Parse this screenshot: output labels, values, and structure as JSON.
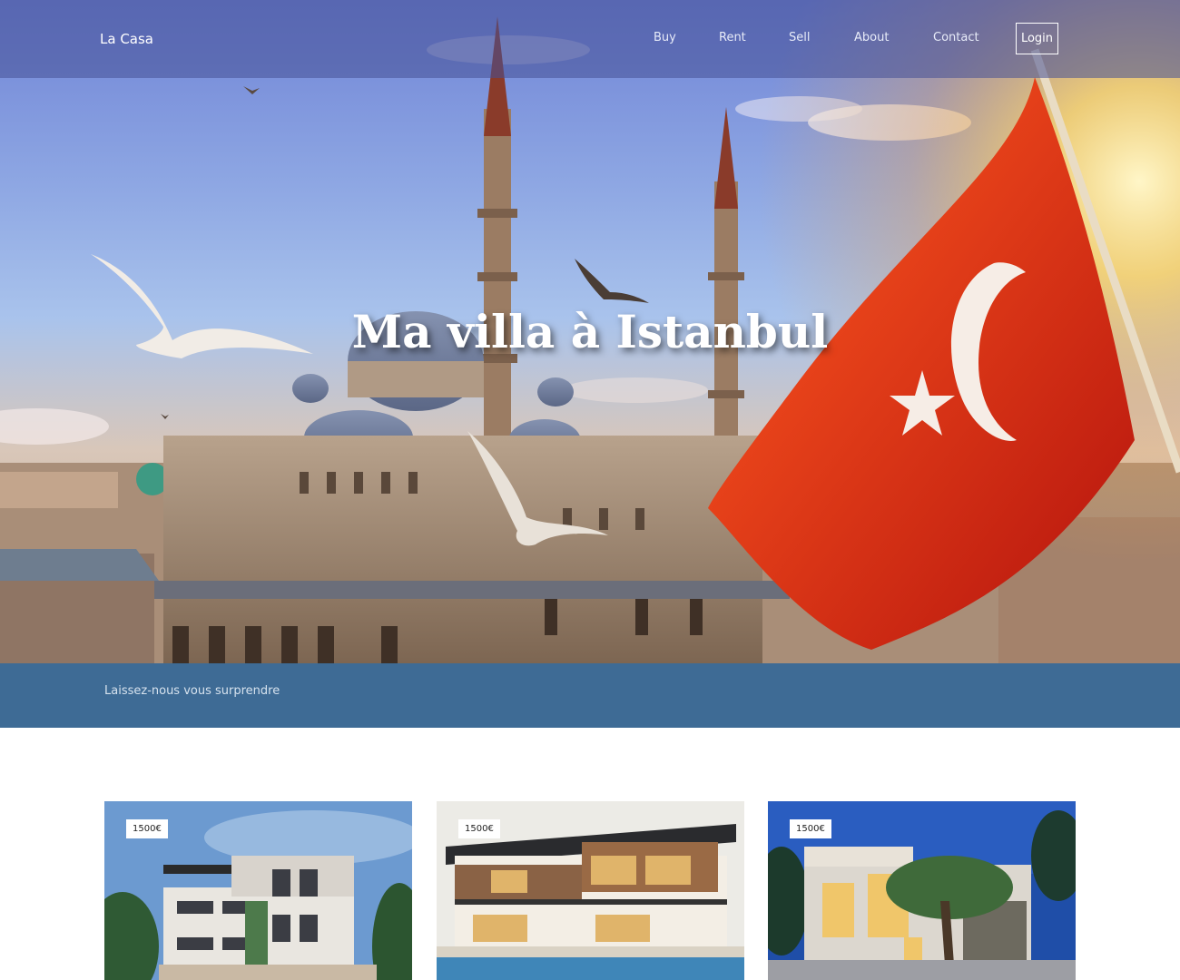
{
  "header": {
    "brand": "La Casa",
    "nav": [
      {
        "label": "Buy"
      },
      {
        "label": "Rent"
      },
      {
        "label": "Sell"
      },
      {
        "label": "About"
      },
      {
        "label": "Contact"
      }
    ],
    "login_label": "Login"
  },
  "hero": {
    "title": "Ma villa à Istanbul",
    "image": "istanbul-mosque-turkish-flag"
  },
  "tagline": {
    "text": "Laissez-nous vous surprendre",
    "background": "#3e6b95"
  },
  "listings": [
    {
      "price": "1500€",
      "image": "modern-white-apartment-building"
    },
    {
      "price": "1500€",
      "image": "modern-wooden-villa-with-pool"
    },
    {
      "price": "1500€",
      "image": "modern-house-at-dusk-with-tree"
    }
  ],
  "colors": {
    "flag_red": "#d81e12",
    "band": "#3e6b95"
  }
}
